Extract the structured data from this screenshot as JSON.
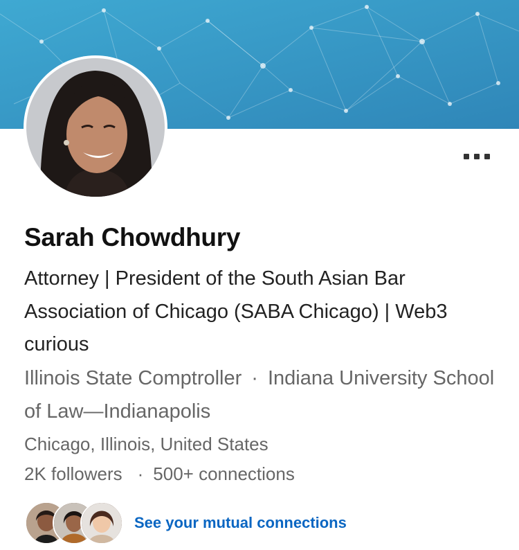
{
  "profile": {
    "name": "Sarah Chowdhury",
    "headline": "Attorney | President of the South Asian Bar Association of Chicago (SABA Chicago) | Web3 curious",
    "current_company": "Illinois State Comptroller",
    "separator": "·",
    "education": "Indiana University School of Law—Indianapolis",
    "location": "Chicago, Illinois, United States",
    "followers": "2K followers",
    "connections": "500+ connections",
    "mutual_link": "See your mutual connections"
  },
  "icons": {
    "more": "more-horizontal-icon"
  },
  "colors": {
    "banner": "#3a9bc9",
    "link": "#0a66c2",
    "primary_text": "#111111",
    "secondary_text": "#666666"
  }
}
